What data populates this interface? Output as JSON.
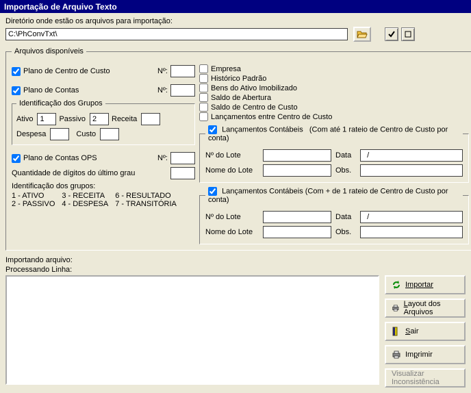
{
  "title": "Importação de Arquivo Texto",
  "dir_label": "Diretório onde estão os arquivos para importação:",
  "dir_value": "C:\\PhConvTxt\\",
  "fieldset_arquivos": "Arquivos disponíveis",
  "left": {
    "plano_centro": "Plano de Centro de Custo",
    "no_label": "Nº:",
    "plano_contas": "Plano de Contas",
    "ident_grupos": "Identificação dos Grupos",
    "ativo": "Ativo",
    "ativo_val": "1",
    "passivo": "Passivo",
    "passivo_val": "2",
    "receita": "Receita",
    "receita_val": "",
    "despesa": "Despesa",
    "despesa_val": "",
    "custo": "Custo",
    "custo_val": "",
    "plano_ops": "Plano de Contas OPS",
    "qtd_digitos": "Quantidade de dígitos do último grau",
    "legend": "Identificação dos grupos:",
    "col1a": "1 - ATIVO",
    "col1b": "2 - PASSIVO",
    "col2a": "3 - RECEITA",
    "col2b": "4 - DESPESA",
    "col3a": "6 - RESULTADO",
    "col3b": "7 - TRANSITÓRIA"
  },
  "right": {
    "empresa": "Empresa",
    "historico": "Histórico Padrão",
    "bens": "Bens do Ativo Imobilizado",
    "saldo_abertura": "Saldo de Abertura",
    "saldo_centro": "Saldo de Centro de Custo",
    "lanc_centros": "Lançamentos entre Centro de Custo",
    "lanc1_label": "Lançamentos Contábeis",
    "lanc1_hint": "(Com até 1 rateio de Centro de Custo por conta)",
    "lanc2_label": "Lançamentos Contábeis (Com + de 1 rateio de Centro de Custo por conta)",
    "n_lote": "Nº do Lote",
    "nome_lote": "Nome do Lote",
    "data": "Data",
    "data_val": "  /",
    "obs": "Obs."
  },
  "status": {
    "importando": "Importando arquivo:",
    "processando": "Processando Linha:"
  },
  "buttons": {
    "importar": "Importar",
    "layout": "Layout dos Arquivos",
    "sair": "Sair",
    "imprimir": "Imprimir",
    "visualizar": "Visualizar Inconsistência"
  }
}
